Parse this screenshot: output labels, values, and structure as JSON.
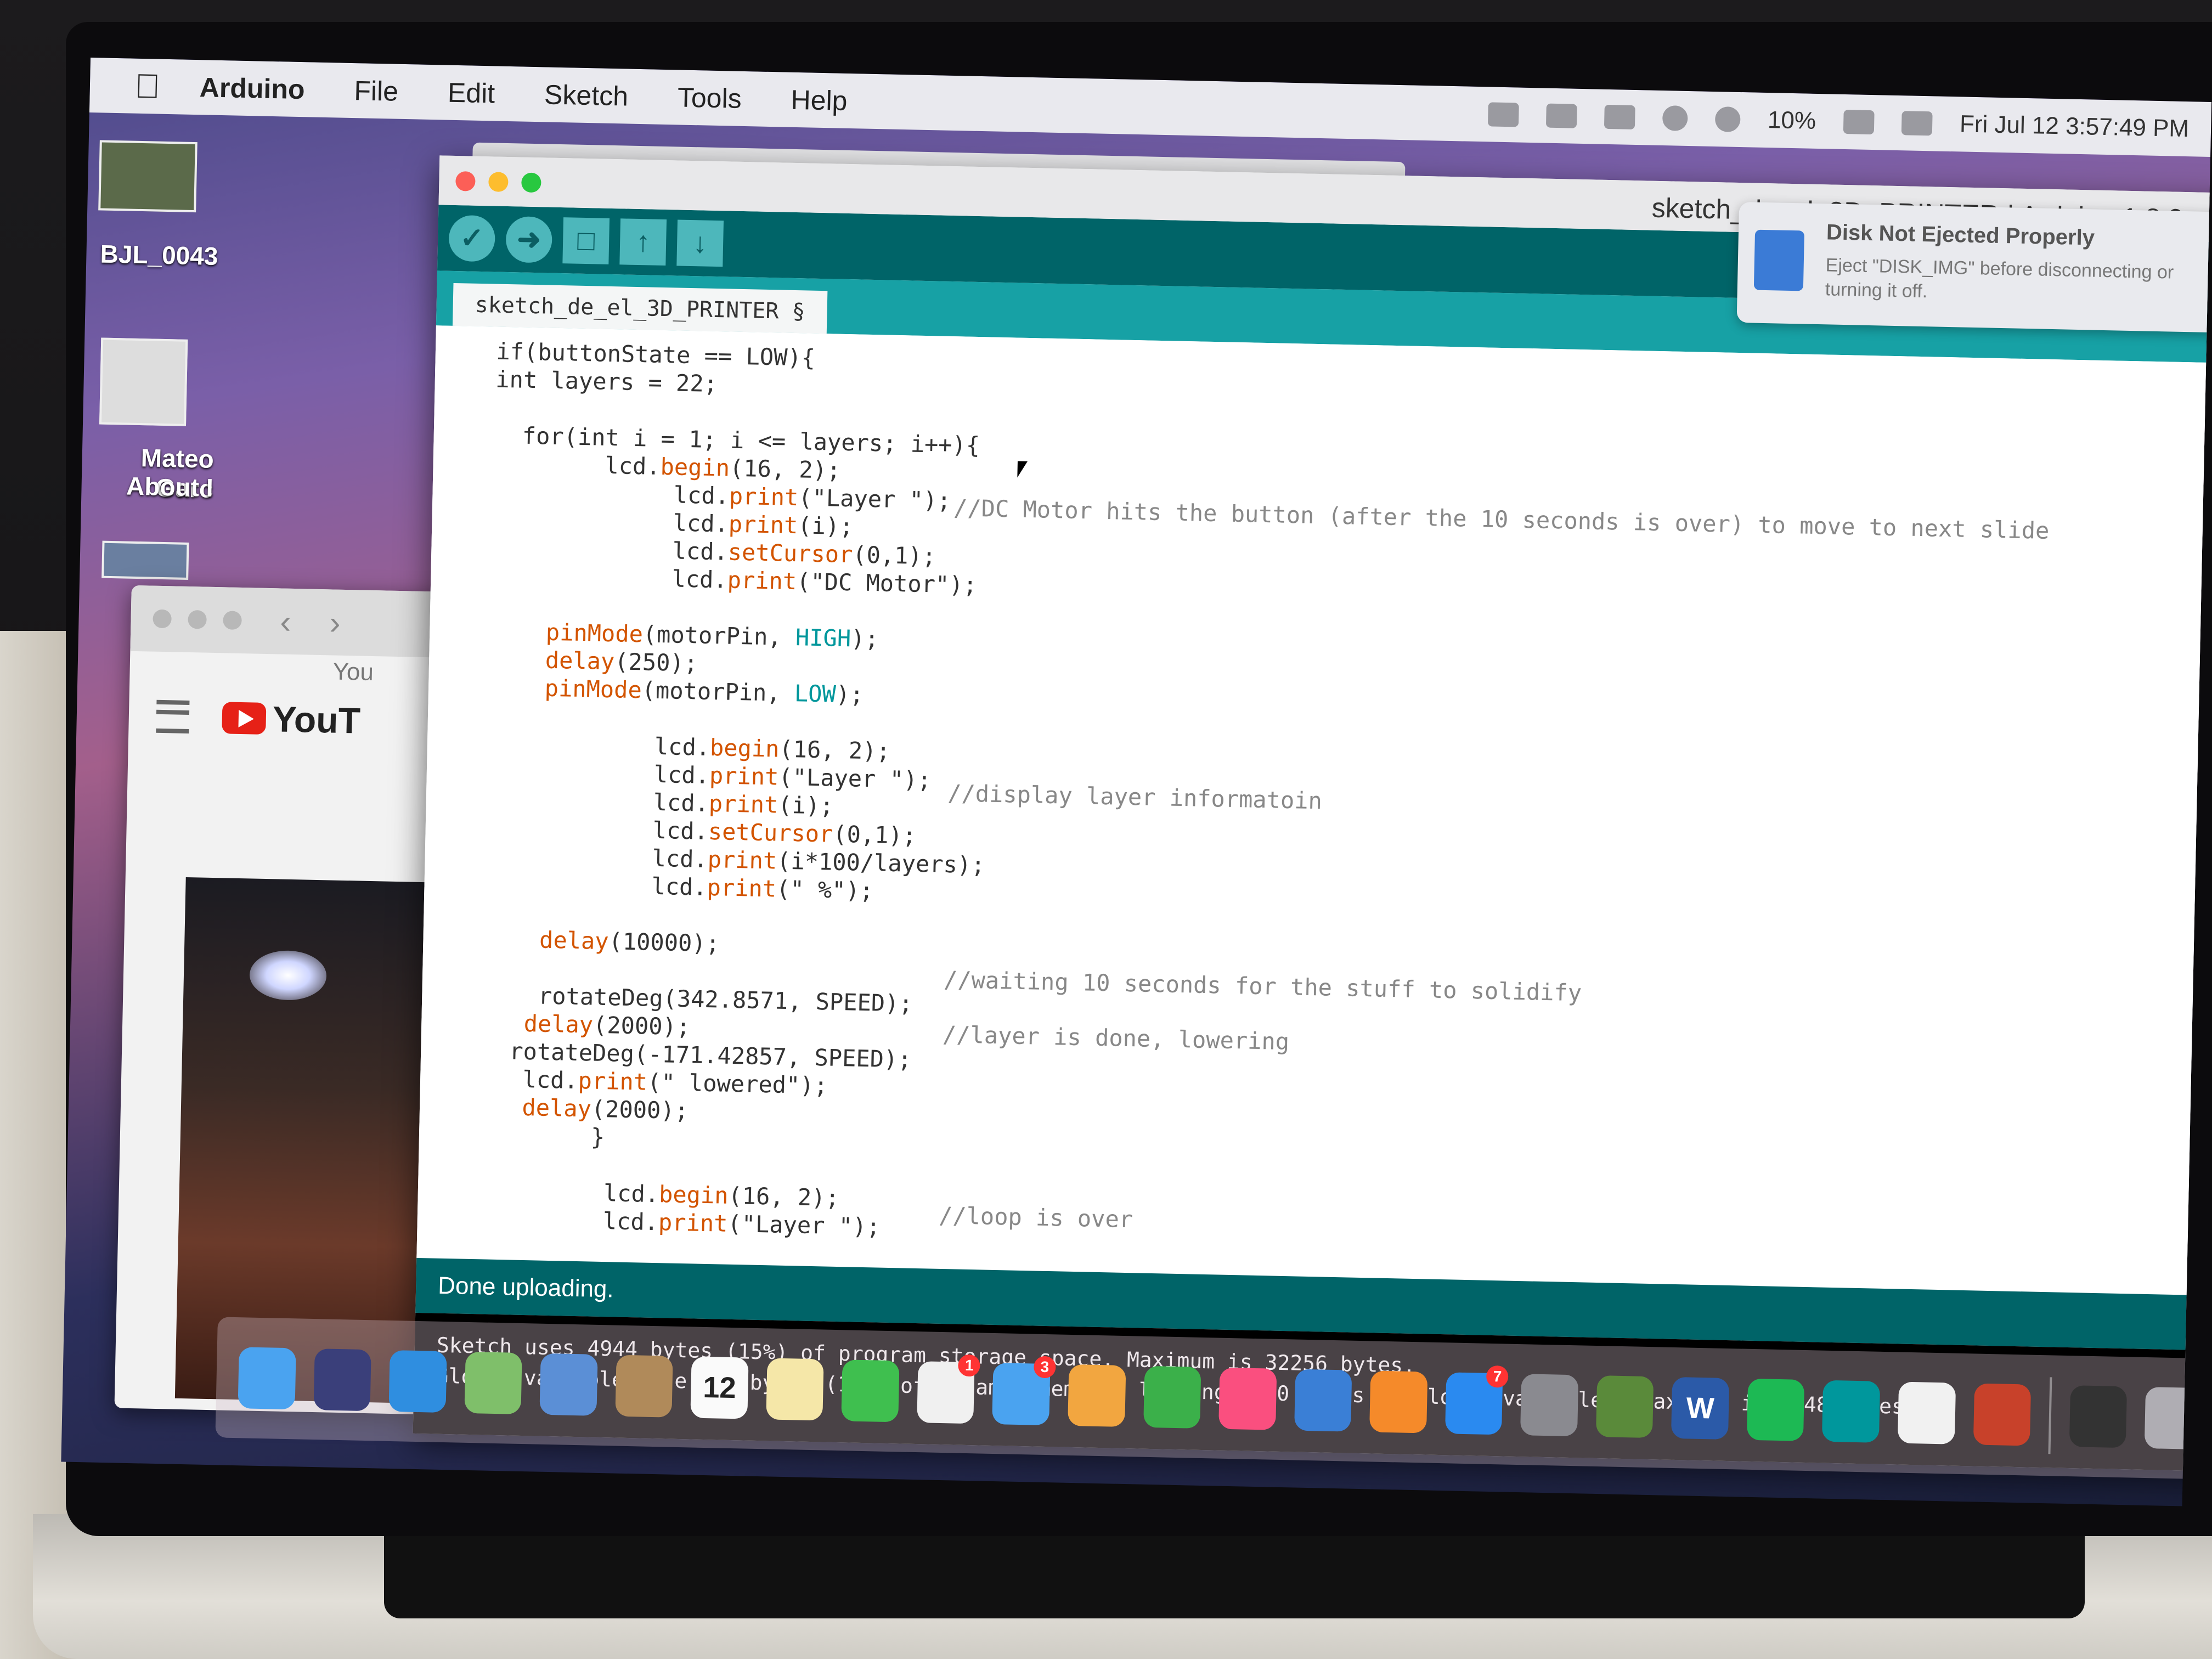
{
  "menubar": {
    "app_name": "Arduino",
    "items": [
      "File",
      "Edit",
      "Sketch",
      "Tools",
      "Help"
    ],
    "battery": "10%",
    "datetime": "Fri Jul 12  3:57:49 PM"
  },
  "desktop": {
    "icon1_label": "BJL_0043",
    "icon2_label_line1": "Mateo Garc",
    "icon2_label_line2": "About I"
  },
  "browser": {
    "you_label": "You",
    "yt_label": "YouT"
  },
  "ide": {
    "title": "sketch_de_el_3D_PRINTER | Arduino 1.8.9",
    "tab": "sketch_de_el_3D_PRINTER §",
    "code": [
      {
        "text": "  if(buttonState == LOW){",
        "cls": ""
      },
      {
        "text": "  int layers = 22;",
        "cls": ""
      },
      {
        "text": "",
        "cls": ""
      },
      {
        "text": "    for(int i = 1; i <= layers; i++){",
        "cls": ""
      },
      {
        "text": "          lcd.begin(16, 2);",
        "cls": ""
      },
      {
        "text": "               lcd.print(\"Layer \");",
        "cls": ""
      },
      {
        "text": "               lcd.print(i);",
        "cls": ""
      },
      {
        "text": "               lcd.setCursor(0,1);",
        "cls": ""
      },
      {
        "text": "               lcd.print(\"DC Motor\");",
        "cls": ""
      },
      {
        "text": "",
        "cls": ""
      },
      {
        "text": "      pinMode(motorPin, HIGH);",
        "cls": ""
      },
      {
        "text": "      delay(250);",
        "cls": ""
      },
      {
        "text": "      pinMode(motorPin, LOW);",
        "cls": ""
      },
      {
        "text": "",
        "cls": ""
      },
      {
        "text": "              lcd.begin(16, 2);",
        "cls": ""
      },
      {
        "text": "              lcd.print(\"Layer \");",
        "cls": ""
      },
      {
        "text": "              lcd.print(i);",
        "cls": ""
      },
      {
        "text": "              lcd.setCursor(0,1);",
        "cls": ""
      },
      {
        "text": "              lcd.print(i*100/layers);",
        "cls": ""
      },
      {
        "text": "              lcd.print(\" %\");",
        "cls": ""
      },
      {
        "text": "",
        "cls": ""
      },
      {
        "text": "      delay(10000);",
        "cls": ""
      },
      {
        "text": "",
        "cls": ""
      },
      {
        "text": "      rotateDeg(342.8571, SPEED);",
        "cls": ""
      },
      {
        "text": "     delay(2000);",
        "cls": ""
      },
      {
        "text": "    rotateDeg(-171.42857, SPEED);",
        "cls": ""
      },
      {
        "text": "     lcd.print(\" lowered\");",
        "cls": ""
      },
      {
        "text": "     delay(2000);",
        "cls": ""
      },
      {
        "text": "          }",
        "cls": ""
      },
      {
        "text": "",
        "cls": ""
      },
      {
        "text": "           lcd.begin(16, 2);",
        "cls": ""
      },
      {
        "text": "           lcd.print(\"Layer \");",
        "cls": ""
      }
    ],
    "comments": {
      "c1": "//DC Motor hits the button (after the 10 seconds is over) to move to next slide",
      "c2": "//display layer informatoin",
      "c3": "//waiting 10 seconds for the stuff to solidify",
      "c4": "//layer is done, lowering",
      "c5": "//loop is over"
    },
    "status": "Done uploading.",
    "console": [
      "Sketch uses 4944 bytes (15%) of program storage space. Maximum is 32256 bytes.",
      "Global variables use 298 bytes (14%) of dynamic memory, leaving 1750 bytes for local variables. Maximum is 2048 bytes."
    ]
  },
  "notification": {
    "title": "Disk Not Ejected Properly",
    "body": "Eject \"DISK_IMG\" before disconnecting or turning it off."
  },
  "dock": {
    "apps": [
      "finder-icon",
      "siri-icon",
      "safari-icon",
      "maps-icon",
      "preview-icon",
      "contacts-icon",
      "calendar-icon",
      "notes-icon",
      "facetime-icon",
      "photos-icon",
      "messages-icon",
      "pages-icon",
      "numbers-icon",
      "itunes-icon",
      "keynote-icon",
      "ibooks-icon",
      "appstore-icon",
      "systemprefs-icon",
      "minecraft-icon",
      "word-icon",
      "spotify-icon",
      "arduino-icon",
      "chrome-icon",
      "powerpoint-icon"
    ],
    "calendar_day": "12",
    "badges": {
      "photos": "1",
      "messages": "3",
      "appstore": "7"
    }
  },
  "colors": {
    "arduino_teal_dark": "#006468",
    "arduino_teal": "#17a1a5",
    "arduino_button": "#4db7bb"
  }
}
